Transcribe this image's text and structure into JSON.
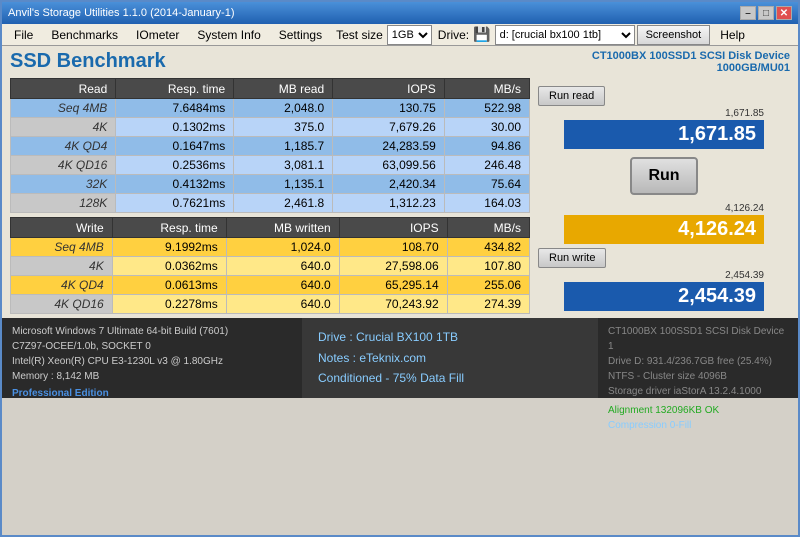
{
  "window": {
    "title": "Anvil's Storage Utilities 1.1.0 (2014-January-1)"
  },
  "titlebar": {
    "min": "–",
    "max": "□",
    "close": "✕"
  },
  "menu": {
    "items": [
      "File",
      "Benchmarks",
      "IOmeter",
      "System Info",
      "Settings"
    ]
  },
  "toolbar": {
    "test_size_label": "Test size",
    "test_size_value": "1GB",
    "drive_label": "Drive:",
    "drive_value": "d: [crucial bx100 1tb]",
    "screenshot_label": "Screenshot",
    "help_label": "Help"
  },
  "benchmark": {
    "title": "SSD Benchmark",
    "device_line1": "CT1000BX 100SSD1 SCSI Disk Device",
    "device_line2": "1000GB/MU01"
  },
  "read_table": {
    "headers": [
      "Read",
      "Resp. time",
      "MB read",
      "IOPS",
      "MB/s"
    ],
    "rows": [
      {
        "label": "Seq 4MB",
        "resp": "7.6484ms",
        "mb": "2,048.0",
        "iops": "130.75",
        "mbs": "522.98",
        "alt": true
      },
      {
        "label": "4K",
        "resp": "0.1302ms",
        "mb": "375.0",
        "iops": "7,679.26",
        "mbs": "30.00",
        "alt": false
      },
      {
        "label": "4K QD4",
        "resp": "0.1647ms",
        "mb": "1,185.7",
        "iops": "24,283.59",
        "mbs": "94.86",
        "alt": true
      },
      {
        "label": "4K QD16",
        "resp": "0.2536ms",
        "mb": "3,081.1",
        "iops": "63,099.56",
        "mbs": "246.48",
        "alt": false
      },
      {
        "label": "32K",
        "resp": "0.4132ms",
        "mb": "1,135.1",
        "iops": "2,420.34",
        "mbs": "75.64",
        "alt": true
      },
      {
        "label": "128K",
        "resp": "0.7621ms",
        "mb": "2,461.8",
        "iops": "1,312.23",
        "mbs": "164.03",
        "alt": false
      }
    ]
  },
  "write_table": {
    "headers": [
      "Write",
      "Resp. time",
      "MB written",
      "IOPS",
      "MB/s"
    ],
    "rows": [
      {
        "label": "Seq 4MB",
        "resp": "9.1992ms",
        "mb": "1,024.0",
        "iops": "108.70",
        "mbs": "434.82",
        "alt": true
      },
      {
        "label": "4K",
        "resp": "0.0362ms",
        "mb": "640.0",
        "iops": "27,598.06",
        "mbs": "107.80",
        "alt": false
      },
      {
        "label": "4K QD4",
        "resp": "0.0613ms",
        "mb": "640.0",
        "iops": "65,295.14",
        "mbs": "255.06",
        "alt": true
      },
      {
        "label": "4K QD16",
        "resp": "0.2278ms",
        "mb": "640.0",
        "iops": "70,243.92",
        "mbs": "274.39",
        "alt": false
      }
    ]
  },
  "scores": {
    "run_read_label": "Run read",
    "run_write_label": "Run write",
    "run_label": "Run",
    "read_score_top": "1,671.85",
    "read_score": "1,671.85",
    "total_score_top": "4,126.24",
    "total_score": "4,126.24",
    "write_score_top": "2,454.39",
    "write_score": "2,454.39"
  },
  "footer": {
    "sys_info": [
      "Microsoft Windows 7 Ultimate  64-bit Build (7601)",
      "C7Z97-OCEE/1.0b, SOCKET 0",
      "Intel(R) Xeon(R) CPU E3-1230L v3 @ 1.80GHz",
      "Memory : 8,142 MB"
    ],
    "professional": "Professional Edition",
    "notes_line1": "Drive : Crucial BX100 1TB",
    "notes_line2": "Notes : eTeknix.com",
    "notes_line3": "Conditioned - 75% Data Fill",
    "device_line1": "CT1000BX 100SSD1 SCSI Disk Device 1",
    "device_line2": "Drive D: 931.4/236.7GB free (25.4%)",
    "device_line3": "NTFS - Cluster size 4096B",
    "device_line4": "Storage driver  iaStorA 13.2.4.1000",
    "device_line5": "",
    "device_line6": "Alignment 132096KB OK",
    "device_line7": "Compression 0-Fill"
  }
}
